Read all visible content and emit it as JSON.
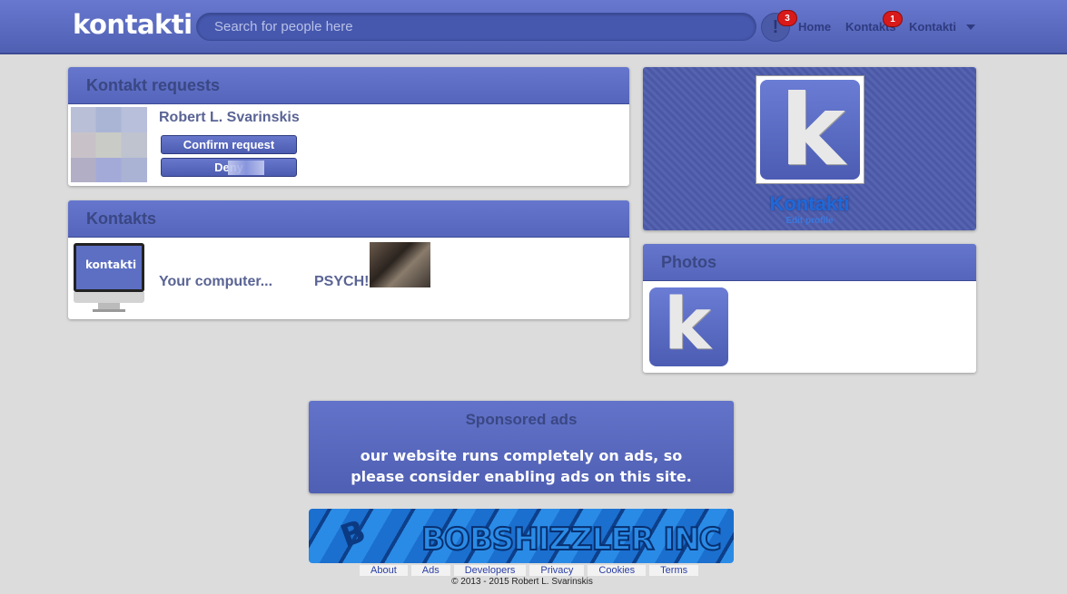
{
  "header": {
    "logo": "kontakti",
    "search_placeholder": "Search for people here",
    "notif_icon_glyph": "!",
    "notif_count": "3",
    "nav": {
      "home": "Home",
      "kontakts": "Kontakts",
      "kontakts_count": "1",
      "profile": "Kontakti"
    }
  },
  "requests_panel": {
    "title": "Kontakt requests",
    "name": "Robert L. Svarinskis",
    "confirm_label": "Confirm request",
    "deny_label": "Deny"
  },
  "kontakts_panel": {
    "title": "Kontakts",
    "thumb_text": "kontakti",
    "post_text_1": "Your computer...",
    "post_text_2": "PSYCH!"
  },
  "profile": {
    "logo_letter": "k",
    "name": "Kontakti",
    "edit_label": "Edit profile"
  },
  "photos_panel": {
    "title": "Photos",
    "photo_letter": "k"
  },
  "ads": {
    "title": "Sponsored ads",
    "line1": "our website runs completely on ads, so",
    "line2": "please consider enabling ads on this site.",
    "banner_logo": "B",
    "banner_text": "BOBSHIZZLER INC"
  },
  "footer": {
    "links": [
      "About",
      "Ads",
      "Developers",
      "Privacy",
      "Cookies",
      "Terms"
    ],
    "copyright": "© 2013 - 2015 Robert L. Svarinskis"
  },
  "colors": {
    "header": "#5566bb",
    "accent": "#4f5fb3",
    "badge": "#d81a1a",
    "background": "#dcdcdc"
  }
}
